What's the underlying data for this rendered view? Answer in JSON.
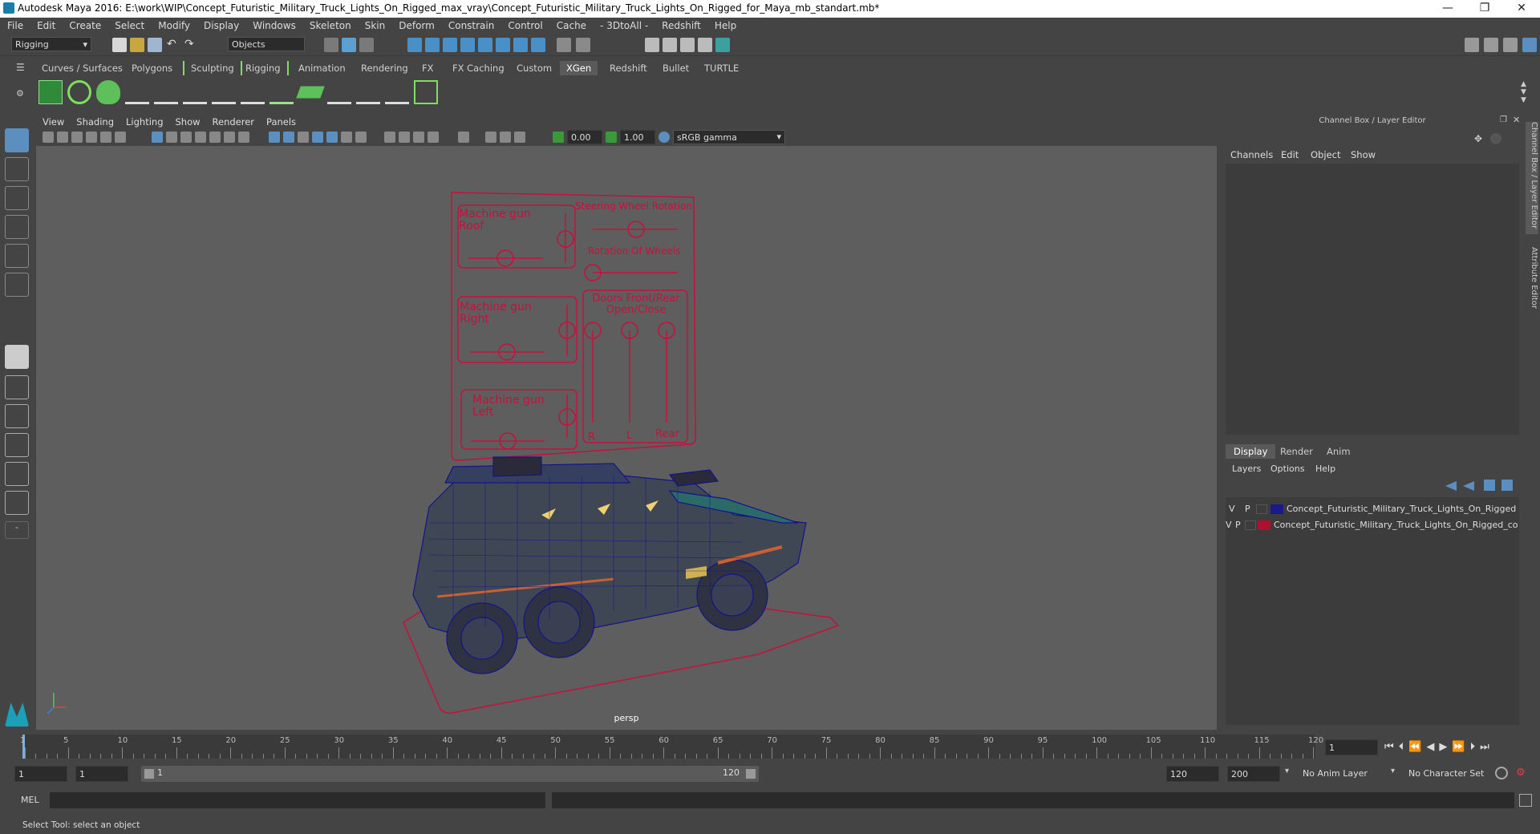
{
  "window": {
    "title": "Autodesk Maya 2016: E:\\work\\WIP\\Concept_Futuristic_Military_Truck_Lights_On_Rigged_max_vray\\Concept_Futuristic_Military_Truck_Lights_On_Rigged_for_Maya_mb_standart.mb*",
    "minimize": "—",
    "restore": "❐",
    "close": "✕"
  },
  "menubar": [
    "File",
    "Edit",
    "Create",
    "Select",
    "Modify",
    "Display",
    "Windows",
    "Skeleton",
    "Skin",
    "Deform",
    "Constrain",
    "Control",
    "Cache",
    "- 3DtoAll -",
    "Redshift",
    "Help"
  ],
  "statusline": {
    "menuset": "Rigging",
    "selection_mode": "Objects"
  },
  "shelf_tabs": [
    "Curves / Surfaces",
    "Polygons",
    "Sculpting",
    "Rigging",
    "Animation",
    "Rendering",
    "FX",
    "FX Caching",
    "Custom",
    "XGen",
    "Redshift",
    "Bullet",
    "TURTLE"
  ],
  "shelf_active": "XGen",
  "viewport": {
    "menu": [
      "View",
      "Shading",
      "Lighting",
      "Show",
      "Renderer",
      "Panels"
    ],
    "exposure": "0.00",
    "gamma": "1.00",
    "color_space": "sRGB gamma",
    "camera": "persp"
  },
  "rig_panel": {
    "labels": {
      "mg_roof": "Machine gun\nRoof",
      "steering": "Steering Wheel Rotation",
      "wheels": "Rotation Of Wheels",
      "mg_right": "Machine gun\nRight",
      "doors": "Doors Front/Rear\nOpen/Close",
      "mg_left": "Machine gun\nLeft",
      "r": "R",
      "l": "L",
      "rear": "Rear"
    },
    "color": "#c8103c"
  },
  "channel_box": {
    "title": "Channel Box / Layer Editor",
    "menu": [
      "Channels",
      "Edit",
      "Object",
      "Show"
    ]
  },
  "layer_editor": {
    "tabs": [
      "Display",
      "Render",
      "Anim"
    ],
    "menu": [
      "Layers",
      "Options",
      "Help"
    ],
    "layers": [
      {
        "v": "V",
        "p": "P",
        "color": "#1a1a8c",
        "name": "Concept_Futuristic_Military_Truck_Lights_On_Rigged"
      },
      {
        "v": "V",
        "p": "P",
        "color": "#b01030",
        "name": "Concept_Futuristic_Military_Truck_Lights_On_Rigged_co"
      }
    ]
  },
  "side_tabs": [
    "Channel Box / Layer Editor",
    "Attribute Editor"
  ],
  "timeline": {
    "ticks": [
      "1",
      "5",
      "10",
      "15",
      "20",
      "25",
      "30",
      "35",
      "40",
      "45",
      "50",
      "55",
      "60",
      "65",
      "70",
      "75",
      "80",
      "85",
      "90",
      "95",
      "100",
      "105",
      "110",
      "115",
      "120"
    ],
    "current_frame": "1"
  },
  "range": {
    "start": "1",
    "inner_start": "1",
    "slider_start": "1",
    "slider_end": "120",
    "end": "120",
    "outer_end": "200",
    "anim_layer": "No Anim Layer",
    "char_set": "No Character Set"
  },
  "cmdline": {
    "label": "MEL"
  },
  "helpline": {
    "text": "Select Tool: select an object"
  }
}
